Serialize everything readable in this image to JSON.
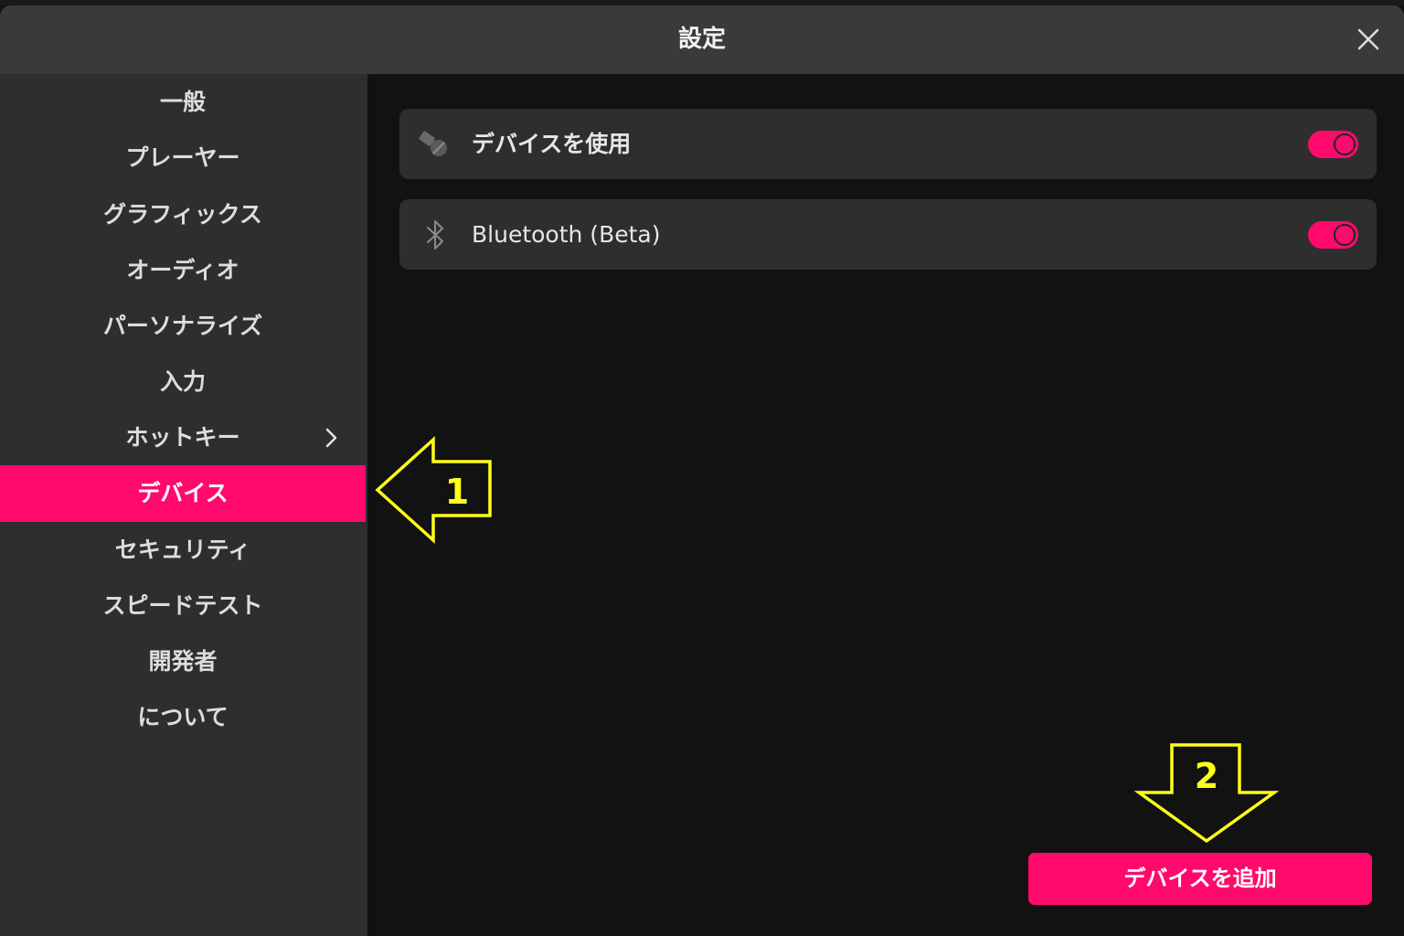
{
  "window": {
    "title": "設定",
    "close_icon": "close-icon"
  },
  "sidebar": {
    "items": [
      {
        "label": "一般"
      },
      {
        "label": "プレーヤー"
      },
      {
        "label": "グラフィックス"
      },
      {
        "label": "オーディオ"
      },
      {
        "label": "パーソナライズ"
      },
      {
        "label": "入力"
      },
      {
        "label": "ホットキー",
        "has_submenu": true
      },
      {
        "label": "デバイス",
        "active": true
      },
      {
        "label": "セキュリティ"
      },
      {
        "label": "スピードテスト"
      },
      {
        "label": "開発者"
      },
      {
        "label": "について"
      }
    ]
  },
  "main": {
    "settings": [
      {
        "label": "デバイスを使用",
        "icon": "device-icon",
        "enabled": true
      },
      {
        "label": "Bluetooth (Beta)",
        "icon": "bluetooth-icon",
        "enabled": true
      }
    ],
    "add_button_label": "デバイスを追加"
  },
  "annotations": {
    "arrow_1_label": "1",
    "arrow_2_label": "2"
  },
  "colors": {
    "accent": "#ff0a6c",
    "annotation": "#ffff1a",
    "sidebar_bg": "#2e2e2e",
    "main_bg": "#121212",
    "titlebar_bg": "#3a3a3a"
  }
}
